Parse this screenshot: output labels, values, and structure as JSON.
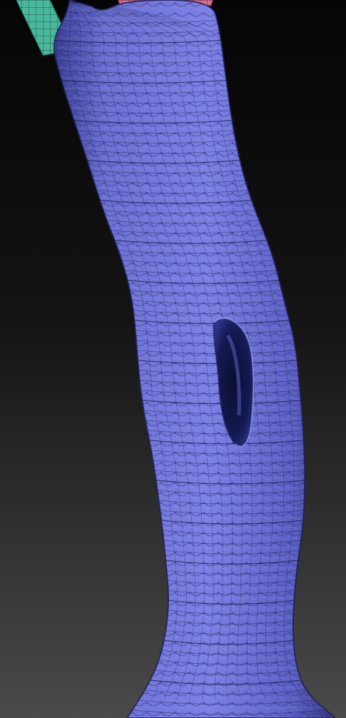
{
  "scene": {
    "subject": "sculpted-tree-trunk-wireframe",
    "colors": {
      "background_top": "#050505",
      "background_bottom": "#4a4a4a",
      "mesh_fill": "#6f74d6",
      "mesh_shadow": "#2c2f70",
      "mesh_highlight": "#a6a9ff",
      "wire": "#14163a",
      "hole": "#0d1035",
      "branch_green": "#48b79a",
      "cap_pink": "#d6708a"
    },
    "icons": {
      "mesh": "tree-trunk-mesh-icon",
      "hole": "knot-hole-icon",
      "branch_stub": "branch-stub-icon",
      "top_cap": "mesh-cap-icon"
    }
  }
}
